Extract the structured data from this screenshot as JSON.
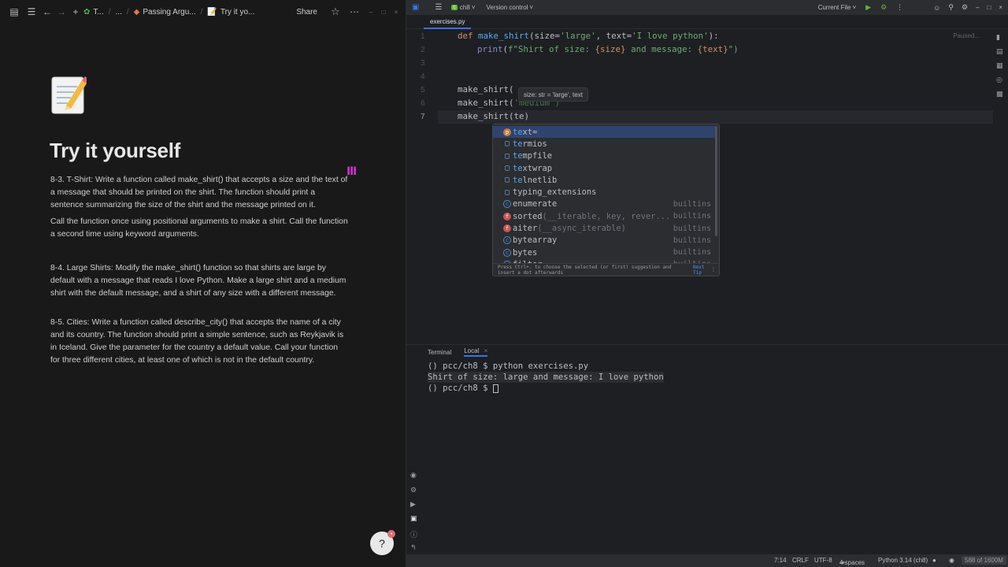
{
  "notion": {
    "breadcrumbs": [
      "T...",
      "...",
      "Passing Argu...",
      "Try it yo..."
    ],
    "share_label": "Share",
    "title": "Try it yourself",
    "paragraphs": [
      "8-3. T-Shirt: Write a function called make_shirt() that accepts a size and the text of a message that should be printed on the shirt. The function should print a sentence summarizing the size of the shirt and the message printed on it.",
      "Call the function once using positional arguments to  make a shirt. Call the function a second time using keyword arguments.",
      "8-4. Large Shirts: Modify the make_shirt() function so that shirts are large by default with a message that reads I love Python. Make a large shirt and a medium shirt with the default message, and a shirt of any size with a different message.",
      "8-5. Cities: Write a function called describe_city() that accepts the name of a city and its country. The function should print a simple sentence, such as Reykjavik is in Iceland. Give the parameter for the country a default value. Call your function for three different cities, at least one of which is not in the default country."
    ],
    "help_badge": "?"
  },
  "ide": {
    "project_badge": "c",
    "project_name": "ch8",
    "vcs_label": "Version control",
    "run_config": "Current File",
    "tab_name": "exercises.py",
    "paused_label": "Paused...",
    "line_numbers": [
      "1",
      "2",
      "3",
      "4",
      "5",
      "6",
      "7"
    ],
    "code": {
      "l1": {
        "kw": "def",
        "fn": "make_shirt",
        "params": "(size=",
        "s1": "'large'",
        "mid": ", text=",
        "s2": "'I love python'",
        "end": "):"
      },
      "l2": {
        "bi": "print",
        "open": "(",
        "s": "f\"Shirt of size: ",
        "var1": "{size}",
        "s2": " and message: ",
        "var2": "{text}",
        "close": "\")"
      },
      "l5": "make_shirt(",
      "l6": "make_shirt(",
      "l6b": "'medium')",
      "l7": "make_shirt(te)"
    },
    "param_hint": "size: str = 'large', text",
    "completion": [
      {
        "name": "text=",
        "kind": "p",
        "src": "",
        "sig": ""
      },
      {
        "name": "termios",
        "kind": "mod",
        "src": "",
        "sig": ""
      },
      {
        "name": "tempfile",
        "kind": "mod",
        "src": "",
        "sig": ""
      },
      {
        "name": "textwrap",
        "kind": "mod",
        "src": "",
        "sig": ""
      },
      {
        "name": "telnetlib",
        "kind": "mod",
        "src": "",
        "sig": ""
      },
      {
        "name": "typing_extensions",
        "kind": "mod",
        "src": "",
        "sig": ""
      },
      {
        "name": "enumerate",
        "kind": "c",
        "src": "builtins",
        "sig": ""
      },
      {
        "name": "sorted",
        "kind": "f",
        "src": "builtins",
        "sig": "(__iterable, key, rever..."
      },
      {
        "name": "aiter",
        "kind": "f",
        "src": "builtins",
        "sig": "(__async_iterable)"
      },
      {
        "name": "bytearray",
        "kind": "c",
        "src": "builtins",
        "sig": ""
      },
      {
        "name": "bytes",
        "kind": "c",
        "src": "builtins",
        "sig": ""
      },
      {
        "name": "filter",
        "kind": "c",
        "src": "builtins",
        "sig": ""
      }
    ],
    "completion_footer": "Press Ctrl+. to choose the selected (or first) suggestion and insert a dot afterwards",
    "completion_footer_link": "Next Tip",
    "terminal_tab": "Terminal",
    "terminal_session": "Local",
    "terminal_lines": [
      "() pcc/ch8 $ python exercises.py",
      "Shirt of size: large and message: I love python",
      "() pcc/ch8 $ "
    ],
    "status": {
      "position": "7:14",
      "line_sep": "CRLF",
      "encoding": "UTF-8",
      "indent": "4 spaces",
      "interpreter": "Python 3.14 (ch8)",
      "memory": "588 of 1600M"
    }
  }
}
